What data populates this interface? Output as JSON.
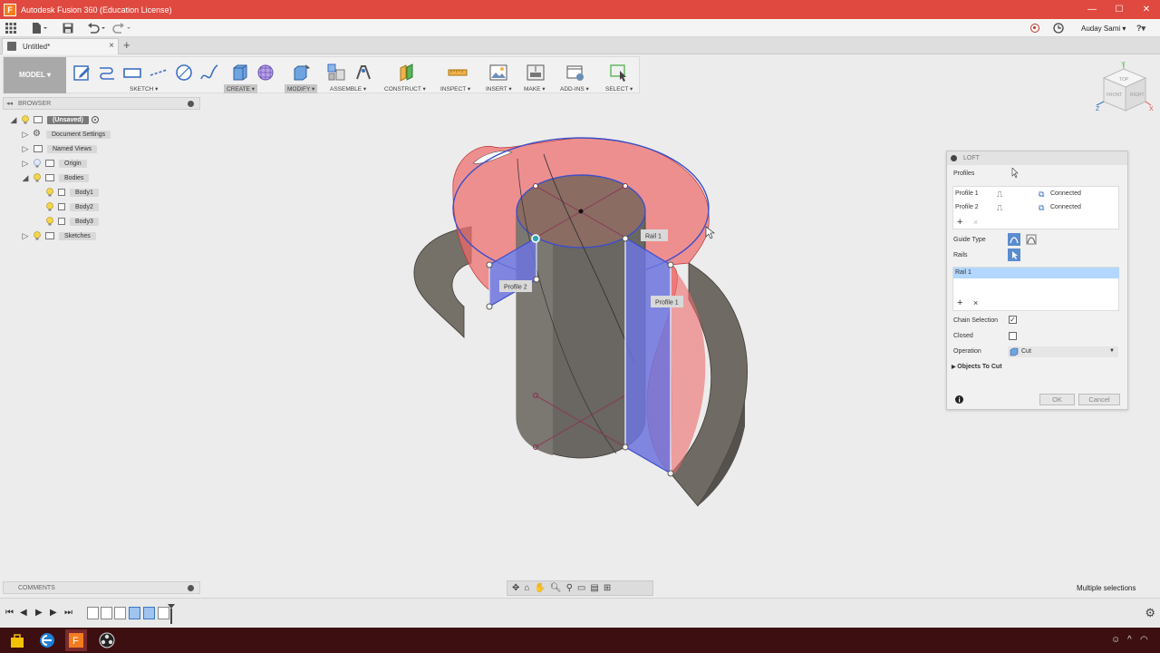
{
  "window": {
    "title": "Autodesk Fusion 360 (Education License)",
    "min": "—",
    "max": "☐",
    "close": "✕"
  },
  "qab": {
    "user": "Auday Sami ▾",
    "help": "?▾"
  },
  "tab": {
    "label": "Untitled*"
  },
  "toolbar": {
    "workspace": "MODEL ▾",
    "groups": {
      "sketch": "SKETCH ▾",
      "create": "CREATE ▾",
      "modify": "MODIFY ▾",
      "assemble": "ASSEMBLE ▾",
      "construct": "CONSTRUCT ▾",
      "inspect": "INSPECT ▾",
      "insert": "INSERT ▾",
      "make": "MAKE ▾",
      "addins": "ADD-INS ▾",
      "select": "SELECT ▾"
    }
  },
  "browser": {
    "title": "BROWSER",
    "root": "(Unsaved)",
    "items": [
      {
        "label": "Document Settings"
      },
      {
        "label": "Named Views"
      },
      {
        "label": "Origin"
      },
      {
        "label": "Bodies"
      },
      {
        "label": "Body1"
      },
      {
        "label": "Body2"
      },
      {
        "label": "Body3"
      },
      {
        "label": "Sketches"
      }
    ]
  },
  "comments": {
    "title": "COMMENTS"
  },
  "viewport": {
    "labels": {
      "rail1": "Rail 1",
      "profile1": "Profile 1",
      "profile2": "Profile 2"
    }
  },
  "loft": {
    "title": "LOFT",
    "profiles_label": "Profiles",
    "profiles": [
      {
        "name": "Profile 1",
        "status": "Connected"
      },
      {
        "name": "Profile 2",
        "status": "Connected"
      }
    ],
    "guide_type_label": "Guide Type",
    "rails_label": "Rails",
    "rails": [
      "Rail 1"
    ],
    "chain_selection_label": "Chain Selection",
    "chain_selection_checked": true,
    "closed_label": "Closed",
    "closed_checked": false,
    "operation_label": "Operation",
    "operation_value": "Cut",
    "objects_to_cut": "Objects To Cut",
    "ok": "OK",
    "cancel": "Cancel"
  },
  "viewcube": {
    "top": "TOP",
    "front": "FRONT",
    "right": "RIGHT",
    "x": "X",
    "y": "Y",
    "z": "Z"
  },
  "status": {
    "text": "Multiple selections"
  },
  "timeline": {
    "first": "⏮",
    "prev": "◀",
    "play": "▶",
    "next": "▶",
    "last": "⏭"
  },
  "tray": {
    "time": ""
  },
  "colors": {
    "titlebar": "#e0493f",
    "accent_blue": "#4a67c9",
    "surface_red": "#ef6b6b",
    "taskbar": "#3d0f11"
  }
}
